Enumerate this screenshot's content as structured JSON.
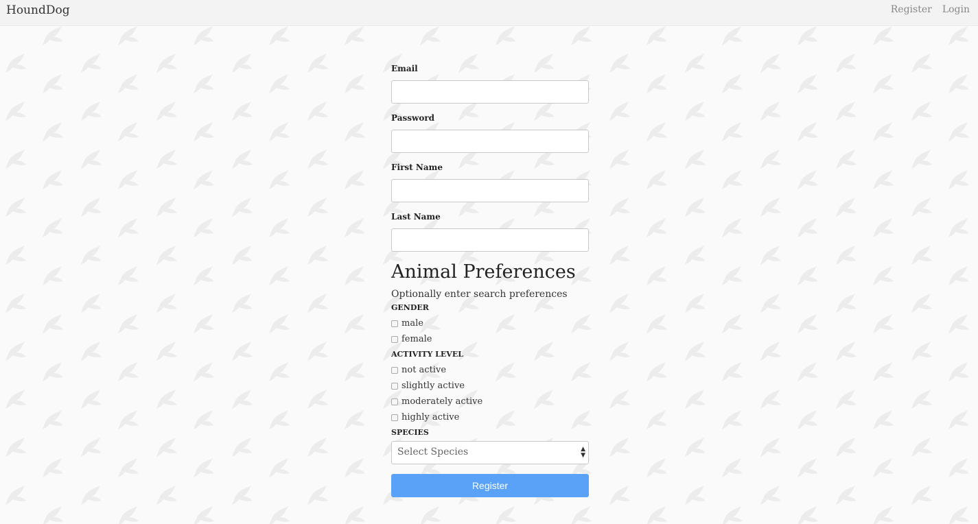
{
  "nav": {
    "brand": "HoundDog",
    "links": [
      "Register",
      "Login"
    ]
  },
  "form": {
    "fields": [
      {
        "label": "Email",
        "value": "",
        "placeholder": ""
      },
      {
        "label": "Password",
        "value": "",
        "placeholder": ""
      },
      {
        "label": "First Name",
        "value": "",
        "placeholder": ""
      },
      {
        "label": "Last Name",
        "value": "",
        "placeholder": ""
      }
    ],
    "preferences": {
      "title": "Animal Preferences",
      "subtitle": "Optionally enter search preferences",
      "gender": {
        "label": "GENDER",
        "options": [
          {
            "label": "male",
            "checked": false
          },
          {
            "label": "female",
            "checked": false
          }
        ]
      },
      "activity": {
        "label": "ACTIVITY LEVEL",
        "options": [
          {
            "label": "not active",
            "checked": false
          },
          {
            "label": "slightly active",
            "checked": false
          },
          {
            "label": "moderately active",
            "checked": false
          },
          {
            "label": "highly active",
            "checked": false
          }
        ]
      },
      "species": {
        "label": "SPECIES",
        "selected": "Select Species"
      }
    },
    "submit_label": "Register"
  },
  "colors": {
    "accent": "#5aa2f7",
    "navbar_bg": "#f3f3f3",
    "page_bg": "#fafafa",
    "pattern": "#ececec"
  },
  "icons": {
    "background": "bird-pattern-icon",
    "select": "select-arrows-icon"
  }
}
